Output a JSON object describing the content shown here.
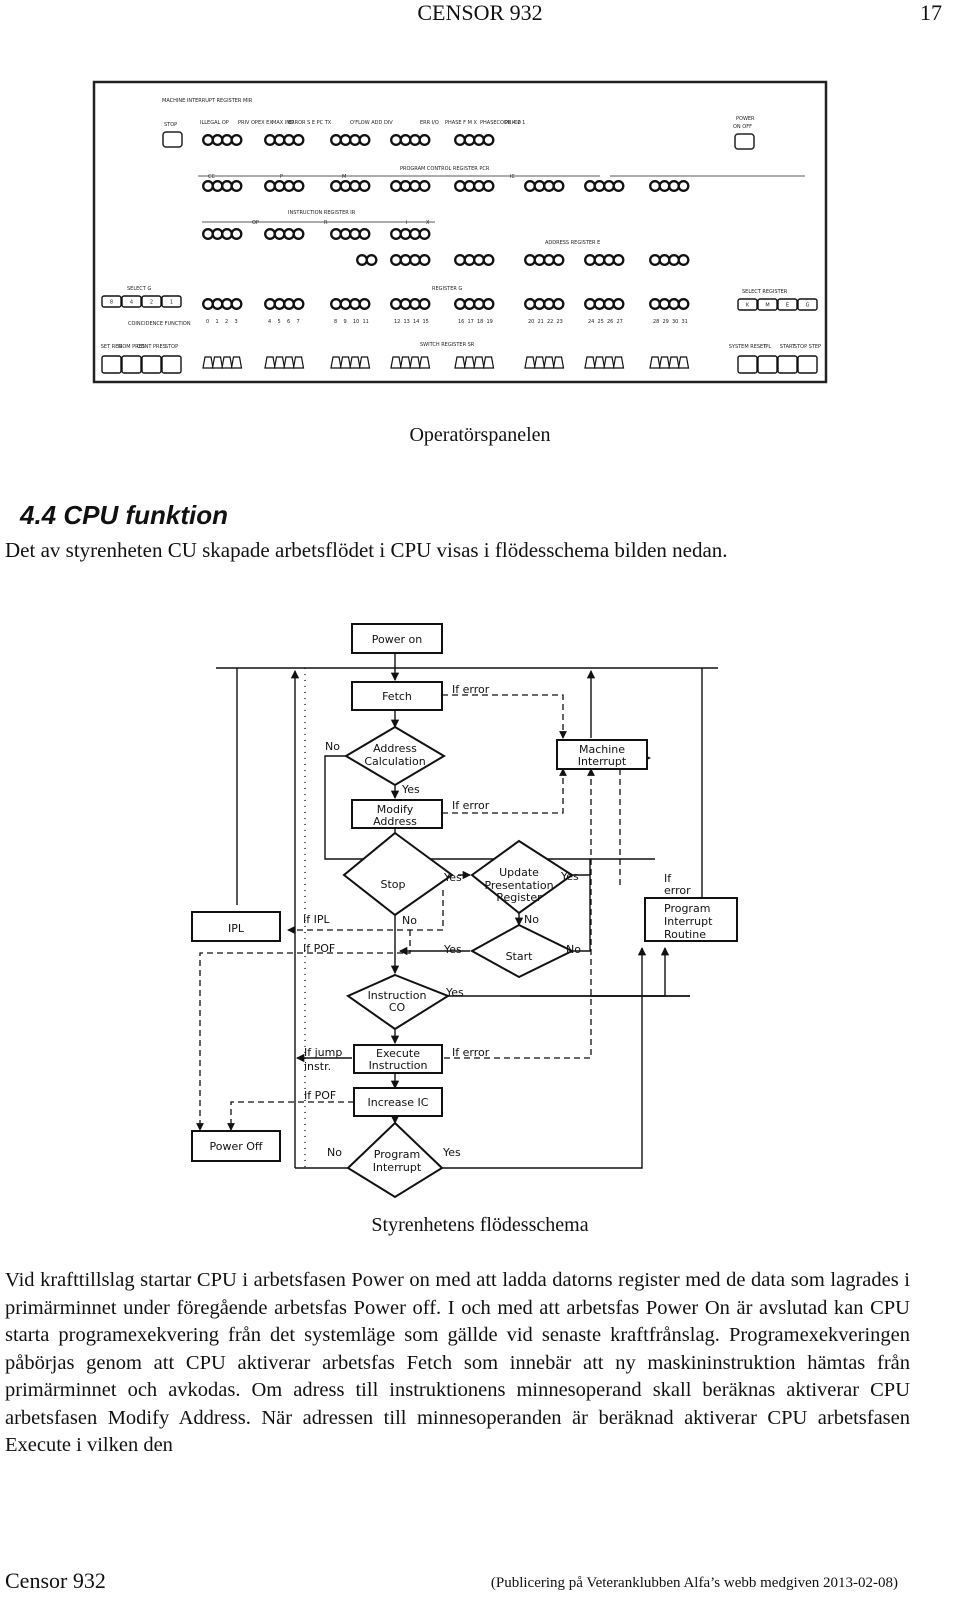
{
  "header": {
    "title": "CENSOR 932",
    "page_number": "17"
  },
  "panel": {
    "caption": "Operatörspanelen",
    "labels": {
      "mir": "MACHINE INTERRUPT REGISTER MIR",
      "stop": "STOP",
      "mir_groups": [
        "ILLEGAL OP",
        "PRIV OP",
        "EX EX",
        "MAX IND",
        "ERROR S E PC TX",
        "O'FLOW ADD DIV",
        "ERR I/O",
        "PHASE F M X",
        "PHASECODE 4 2 1",
        "PRI 00"
      ],
      "power": "POWER",
      "power_on_off": "ON OFF",
      "pcr": "PROGRAM CONTROL REGISTER PCR",
      "cc": "CC",
      "p": "P",
      "m": "M",
      "ic": "IC",
      "ir": "INSTRUCTION REGISTER IR",
      "op": "OP",
      "r": "R",
      "i": "I",
      "x": "X",
      "ar": "ADDRESS REGISTER E",
      "select_g": "SELECT G",
      "select_g_keys": [
        "8",
        "4",
        "2",
        "1"
      ],
      "coincidence": "COINCIDENCE FUNCTION",
      "coinc_keys": [
        "SET REG",
        "MOM PRES",
        "CONT PRES",
        "STOP"
      ],
      "register_g": "REGISTER G",
      "switch_register": "SWITCH REGISTER SR",
      "select_register": "SELECT REGISTER",
      "select_register_keys": [
        "K",
        "M",
        "E",
        "G"
      ],
      "system_keys": [
        "SYSTEM RESET",
        "IPL",
        "START",
        "STOP STEP"
      ],
      "bit_numbers": [
        "0",
        "1",
        "2",
        "3",
        "4",
        "5",
        "6",
        "7",
        "8",
        "9",
        "10",
        "11",
        "12",
        "13",
        "14",
        "15",
        "16",
        "17",
        "18",
        "19",
        "20",
        "21",
        "22",
        "23",
        "24",
        "25",
        "26",
        "27",
        "28",
        "29",
        "30",
        "31"
      ]
    }
  },
  "section": {
    "heading": "4.4  CPU funktion",
    "lead": "Det av styrenheten CU skapade arbetsflödet i CPU visas i flödesschema bilden nedan."
  },
  "flowchart": {
    "caption": "Styrenhetens flödesschema",
    "nodes": {
      "power_on": "Power on",
      "fetch": "Fetch",
      "address_calc": [
        "Address",
        "Calculation"
      ],
      "modify_address": [
        "Modify",
        "Address"
      ],
      "machine_interrupt": [
        "Machine",
        "Interrupt"
      ],
      "stop": "Stop",
      "update_presentation": [
        "Update",
        "Presentation",
        "Register"
      ],
      "start": "Start",
      "ipl": "IPL",
      "program_interrupt_routine": [
        "Program",
        "Interrupt",
        "Routine"
      ],
      "instruction_co": [
        "Instruction",
        "CO"
      ],
      "execute_instruction": [
        "Execute",
        "Instruction"
      ],
      "increase_ic": "Increase IC",
      "power_off": "Power Off",
      "program_interrupt": [
        "Program",
        "Interrupt"
      ]
    },
    "edge_labels": {
      "if_error": "If error",
      "no": "No",
      "yes": "Yes",
      "if_ipl": "If IPL",
      "if_pof": "If POF",
      "if_jump": "If jump",
      "instr": "instr.",
      "if": "If",
      "error": "error"
    }
  },
  "paragraph": [
    "Vid krafttillslag startar CPU i arbetsfasen Power on med att ladda datorns register med de data som lagrades i primärminnet under föregående arbetsfas Power off. I och med att arbetsfas Power On är avslutad kan CPU starta programexekvering från det systemläge som gällde vid senaste kraftfrånslag. Programexekveringen påbörjas genom att CPU aktiverar arbetsfas Fetch som innebär att ny maskininstruktion hämtas från primärminnet och avkodas. Om adress till instruktionens minnesoperand skall beräknas aktiverar CPU arbetsfasen Modify Address. När adressen till minnesoperanden är beräknad aktiverar CPU arbetsfasen Execute i vilken den"
  ],
  "footer": {
    "left": "Censor 932",
    "right": "(Publicering på Veteranklubben Alfa’s webb medgiven 2013-02-08)"
  }
}
